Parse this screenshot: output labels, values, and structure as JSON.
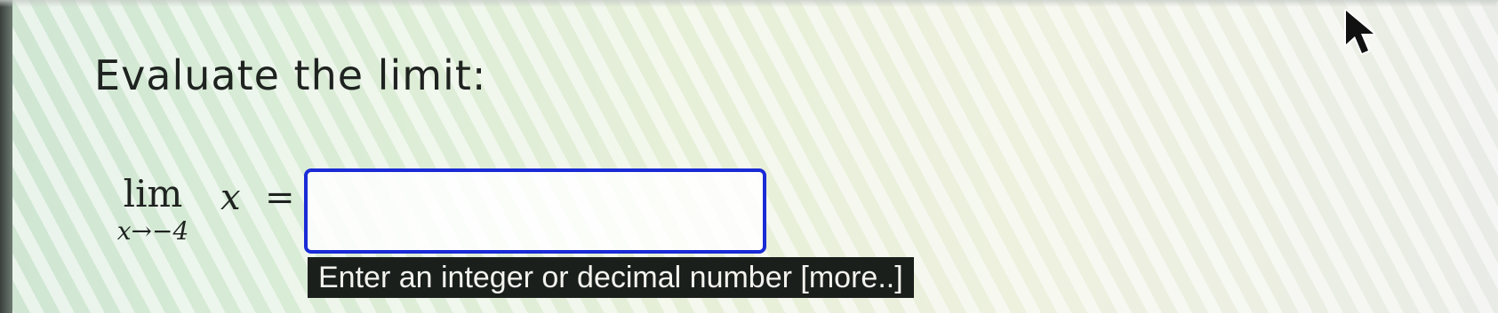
{
  "question": {
    "heading": "Evaluate the limit:"
  },
  "limit": {
    "operator": "lim",
    "subscript": "x→−4",
    "variable": "x",
    "equals": "="
  },
  "answer": {
    "value": "",
    "placeholder": ""
  },
  "hint": {
    "text": "Enter an integer or decimal number",
    "more_link": "[more..]"
  },
  "icons": {
    "cursor": "mouse-pointer-icon"
  },
  "colors": {
    "input_border": "#1a2bd6",
    "hint_background": "#1b1f1c"
  }
}
